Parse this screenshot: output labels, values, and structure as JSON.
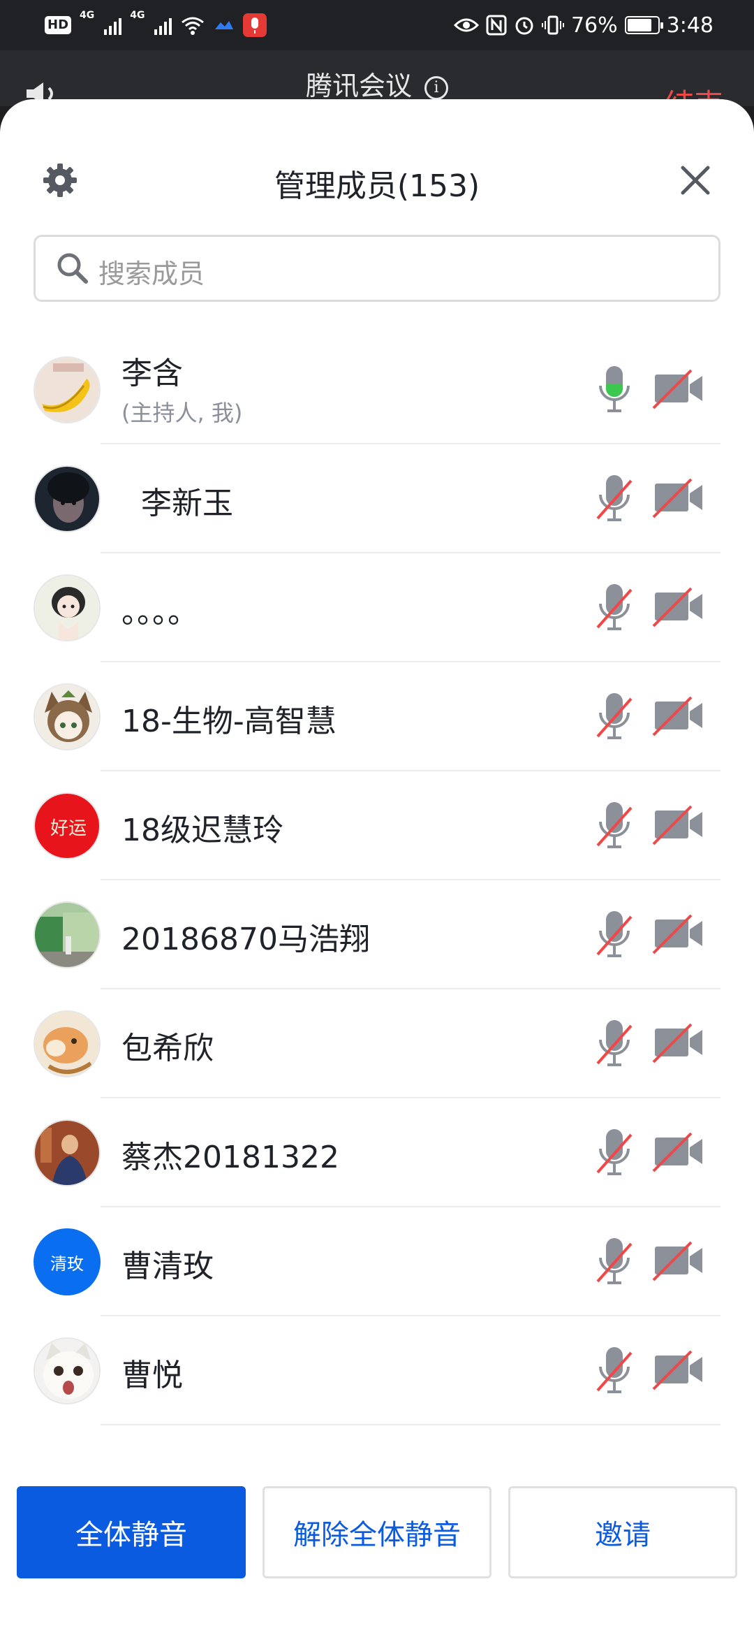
{
  "status_bar": {
    "hd": "HD",
    "net1": "4G",
    "net2": "4G",
    "battery": "76%",
    "time": "3:48"
  },
  "meeting": {
    "title": "腾讯会议",
    "end_label": "结束"
  },
  "sheet": {
    "title": "管理成员(153)",
    "search_placeholder": "搜索成员"
  },
  "members": [
    {
      "name": "李含",
      "sub": "(主持人, 我)",
      "mic": "on",
      "cam": "off",
      "avatar": "banana"
    },
    {
      "name": "  李新玉",
      "sub": "",
      "mic": "off",
      "cam": "off",
      "avatar": "dark"
    },
    {
      "name": "。。。。",
      "sub": "",
      "mic": "off",
      "cam": "off",
      "avatar": "girl"
    },
    {
      "name": "18-生物-高智慧",
      "sub": "",
      "mic": "off",
      "cam": "off",
      "avatar": "anime"
    },
    {
      "name": "18级迟慧玲",
      "sub": "",
      "mic": "off",
      "cam": "off",
      "avatar": "red"
    },
    {
      "name": "20186870马浩翔",
      "sub": "",
      "mic": "off",
      "cam": "off",
      "avatar": "street"
    },
    {
      "name": "包希欣",
      "sub": "",
      "mic": "off",
      "cam": "off",
      "avatar": "fox"
    },
    {
      "name": "蔡杰20181322",
      "sub": "",
      "mic": "off",
      "cam": "off",
      "avatar": "painting"
    },
    {
      "name": "曹清玫",
      "sub": "",
      "mic": "off",
      "cam": "off",
      "avatar": "text",
      "avatar_text": "清玫"
    },
    {
      "name": "曹悦",
      "sub": "",
      "mic": "off",
      "cam": "off",
      "avatar": "cat"
    }
  ],
  "actions": {
    "mute_all": "全体静音",
    "unmute_all": "解除全体静音",
    "invite": "邀请"
  },
  "colors": {
    "accent": "#0a5be0",
    "danger": "#f04848",
    "mic_active": "#3cc850"
  }
}
